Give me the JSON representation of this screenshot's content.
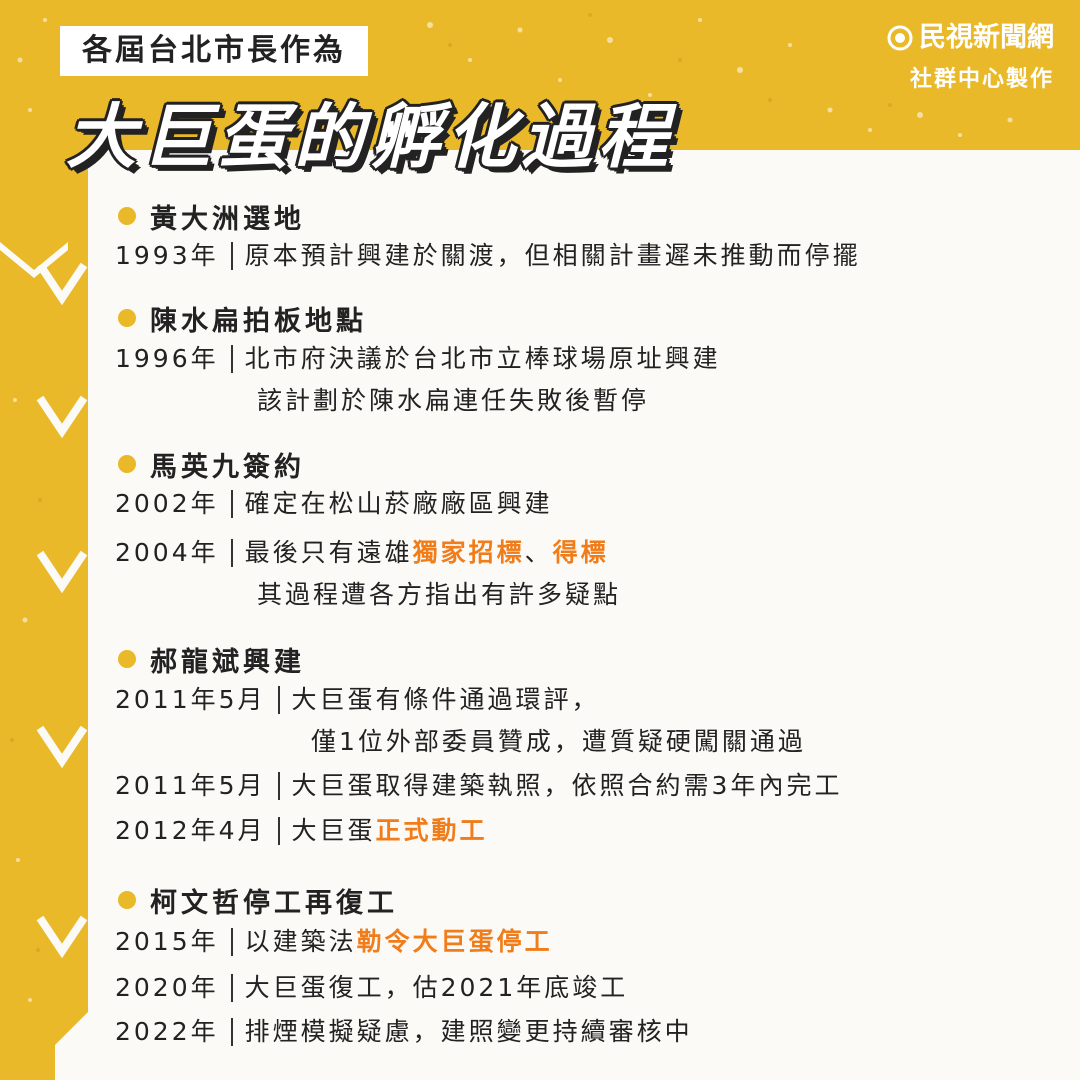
{
  "colors": {
    "accent": "#e9b92a",
    "highlight": "#f07d1a",
    "text": "#222222"
  },
  "header": {
    "tag": "各屆台北市長作為",
    "title": "大巨蛋的孵化過程"
  },
  "brand": {
    "name": "民視新聞網",
    "credit": "社群中心製作",
    "icon": "ftv-logo-icon"
  },
  "sections": [
    {
      "title": "黃大洲選地",
      "rows": [
        {
          "date": "1993年",
          "text": "原本預計興建於關渡，但相關計畫遲未推動而停擺"
        }
      ]
    },
    {
      "title": "陳水扁拍板地點",
      "rows": [
        {
          "date": "1996年",
          "text": "北市府決議於台北市立棒球場原址興建",
          "text2": "該計劃於陳水扁連任失敗後暫停"
        }
      ]
    },
    {
      "title": "馬英九簽約",
      "rows": [
        {
          "date": "2002年",
          "text": "確定在松山菸廠廠區興建"
        },
        {
          "date": "2004年",
          "pre": "最後只有遠雄",
          "hl1": "獨家招標",
          "mid": "、",
          "hl2": "得標",
          "text2": "其過程遭各方指出有許多疑點"
        }
      ]
    },
    {
      "title": "郝龍斌興建",
      "rows": [
        {
          "date": "2011年5月",
          "text": "大巨蛋有條件通過環評，",
          "text2": "僅1位外部委員贊成，遭質疑硬闖關通過"
        },
        {
          "date": "2011年5月",
          "text": "大巨蛋取得建築執照，依照合約需3年內完工"
        },
        {
          "date": "2012年4月",
          "pre": "大巨蛋",
          "hl1": "正式動工"
        }
      ]
    },
    {
      "title": "柯文哲停工再復工",
      "rows": [
        {
          "date": "2015年",
          "pre": "以建築法",
          "hl1": "勒令大巨蛋停工"
        },
        {
          "date": "2020年",
          "text": "大巨蛋復工，估2021年底竣工"
        },
        {
          "date": "2022年",
          "text": "排煙模擬疑慮，建照變更持續審核中"
        }
      ]
    }
  ]
}
